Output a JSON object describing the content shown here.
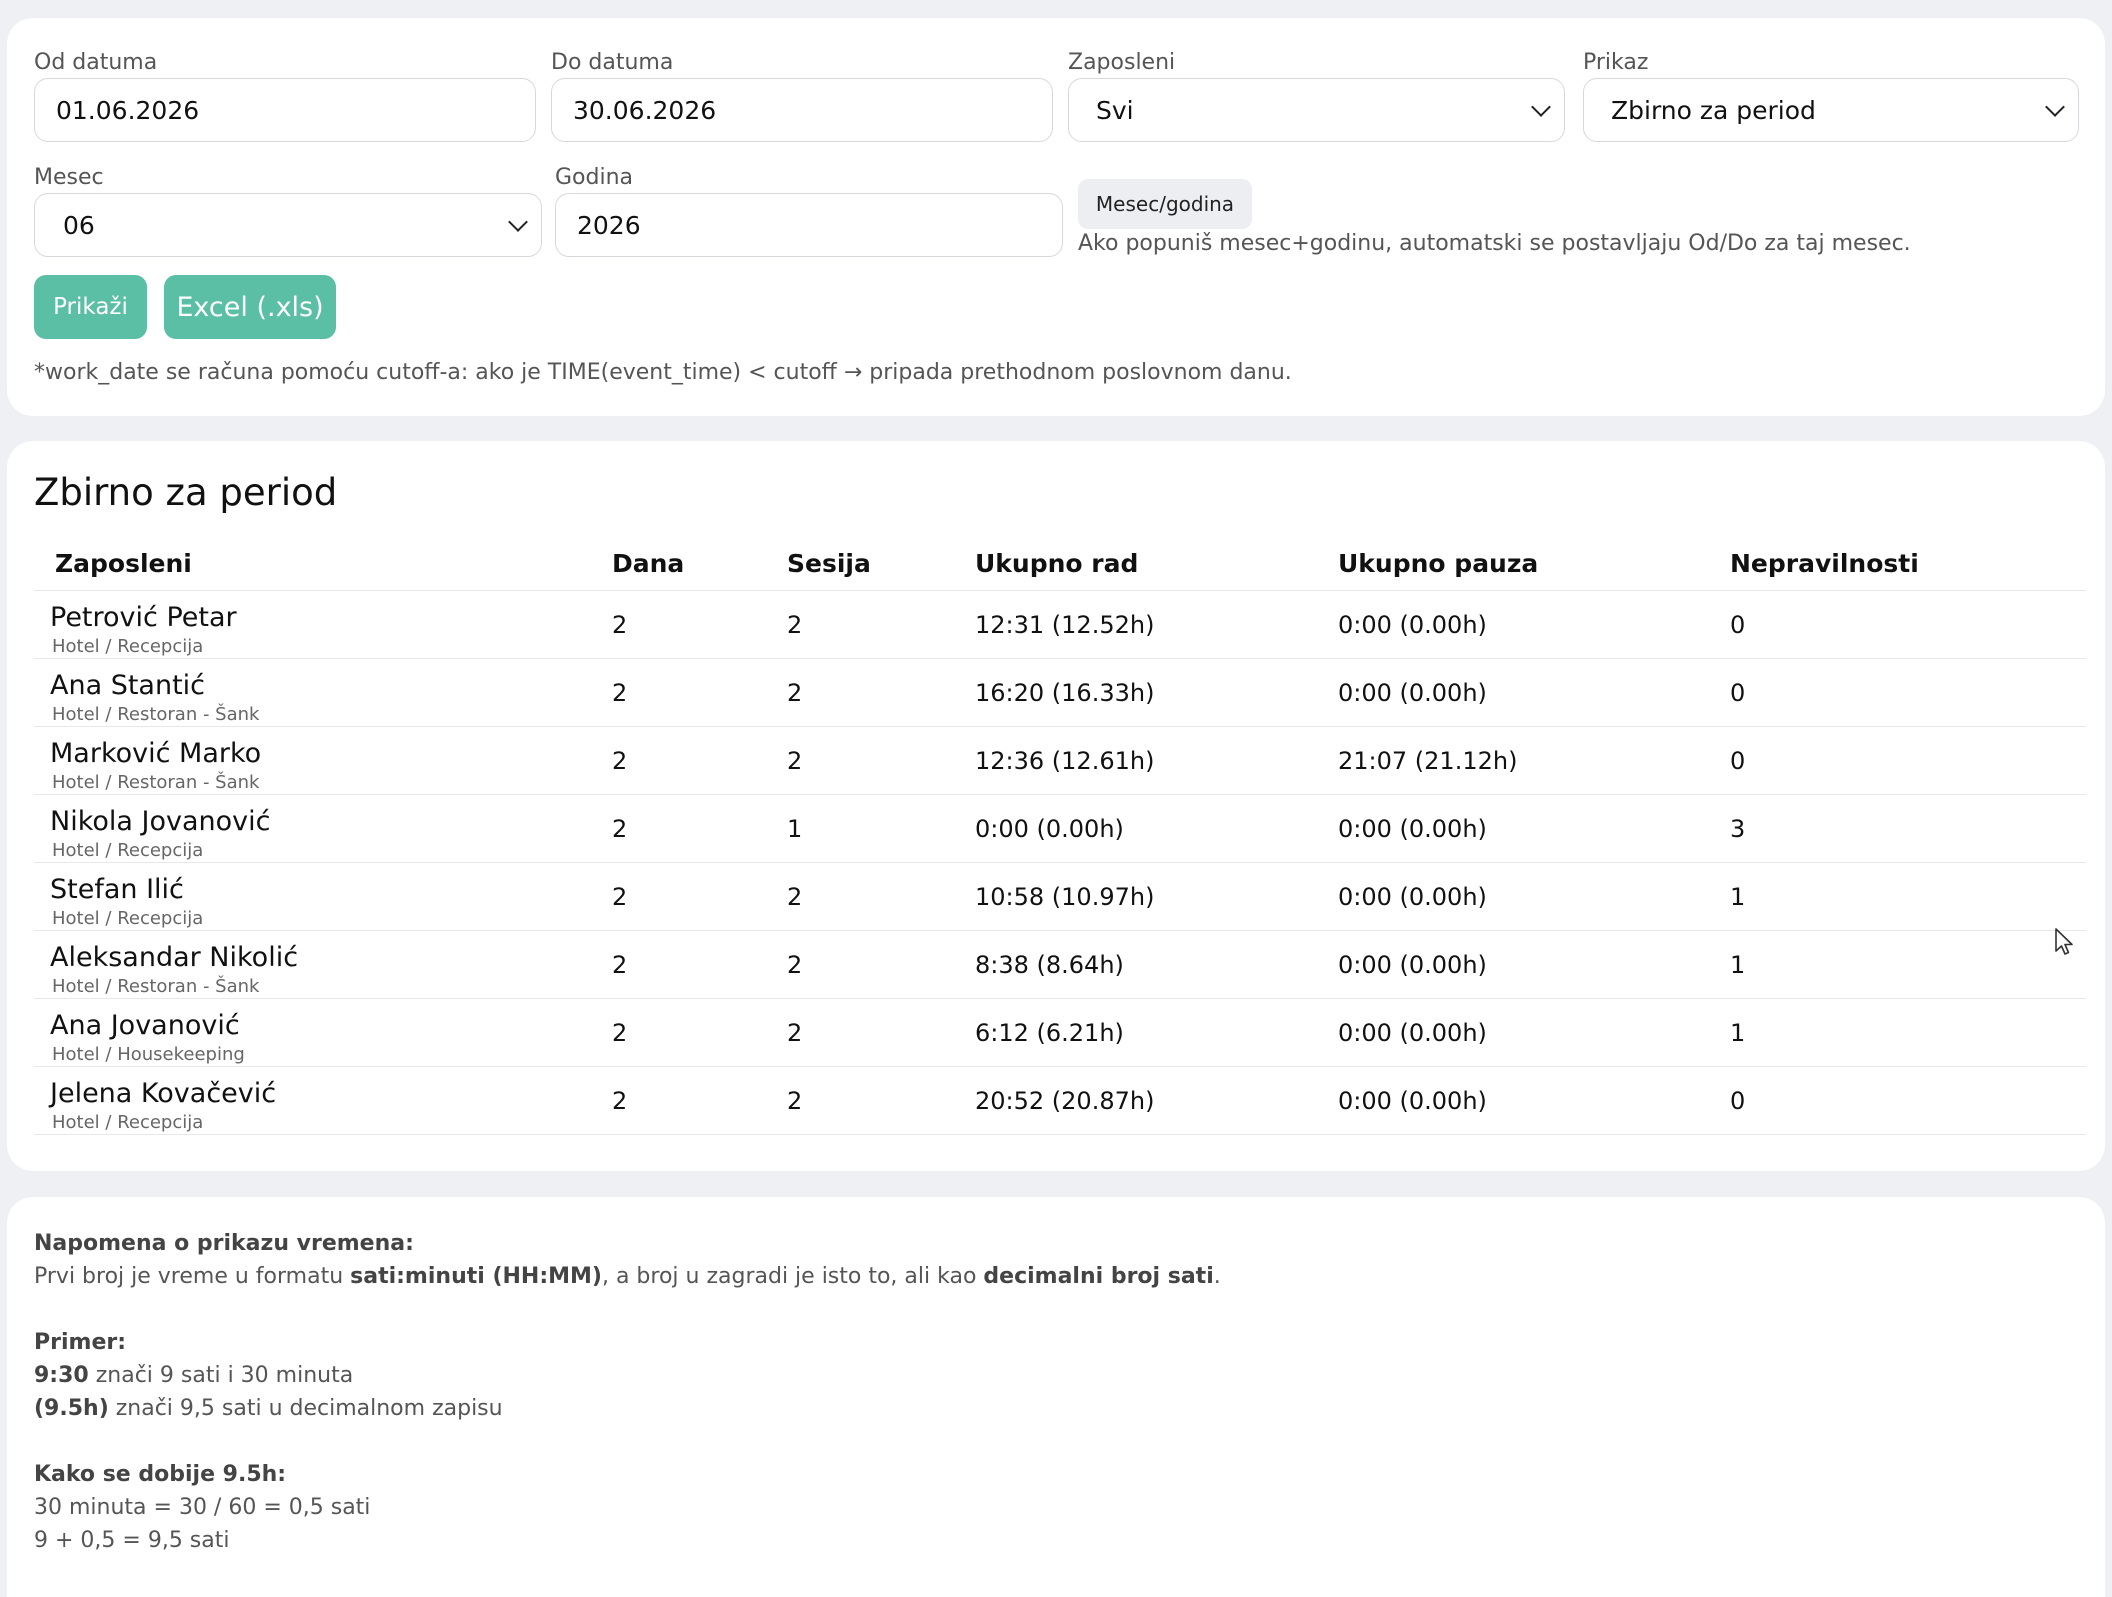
{
  "filters": {
    "from_label": "Od datuma",
    "from_value": "01.06.2026",
    "to_label": "Do datuma",
    "to_value": "30.06.2026",
    "employee_label": "Zaposleni",
    "employee_value": "Svi",
    "view_label": "Prikaz",
    "view_value": "Zbirno za period",
    "month_label": "Mesec",
    "month_value": "06",
    "year_label": "Godina",
    "year_value": "2026",
    "month_year_button": "Mesec/godina",
    "month_year_hint": "Ako popuniš mesec+godinu, automatski se postavljaju Od/Do za taj mesec.",
    "show_button": "Prikaži",
    "excel_button": "Excel (.xls)",
    "cutoff_note": "*work_date se računa pomoću cutoff-a: ako je TIME(event_time) < cutoff → pripada prethodnom poslovnom danu."
  },
  "results": {
    "title": "Zbirno za period",
    "columns": [
      "Zaposleni",
      "Dana",
      "Sesija",
      "Ukupno rad",
      "Ukupno pauza",
      "Nepravilnosti"
    ],
    "rows": [
      {
        "name": "Petrović Petar",
        "dept": "Hotel / Recepcija",
        "days": "2",
        "sessions": "2",
        "work": "12:31 (12.52h)",
        "pause": "0:00 (0.00h)",
        "irregular": "0"
      },
      {
        "name": "Ana Stantić",
        "dept": "Hotel / Restoran - Šank",
        "days": "2",
        "sessions": "2",
        "work": "16:20 (16.33h)",
        "pause": "0:00 (0.00h)",
        "irregular": "0"
      },
      {
        "name": "Marković Marko",
        "dept": "Hotel / Restoran - Šank",
        "days": "2",
        "sessions": "2",
        "work": "12:36 (12.61h)",
        "pause": "21:07 (21.12h)",
        "irregular": "0"
      },
      {
        "name": "Nikola Jovanović",
        "dept": "Hotel / Recepcija",
        "days": "2",
        "sessions": "1",
        "work": "0:00 (0.00h)",
        "pause": "0:00 (0.00h)",
        "irregular": "3"
      },
      {
        "name": "Stefan Ilić",
        "dept": "Hotel / Recepcija",
        "days": "2",
        "sessions": "2",
        "work": "10:58 (10.97h)",
        "pause": "0:00 (0.00h)",
        "irregular": "1"
      },
      {
        "name": "Aleksandar Nikolić",
        "dept": "Hotel / Restoran - Šank",
        "days": "2",
        "sessions": "2",
        "work": "8:38 (8.64h)",
        "pause": "0:00 (0.00h)",
        "irregular": "1"
      },
      {
        "name": "Ana Jovanović",
        "dept": "Hotel / Housekeeping",
        "days": "2",
        "sessions": "2",
        "work": "6:12 (6.21h)",
        "pause": "0:00 (0.00h)",
        "irregular": "1"
      },
      {
        "name": "Jelena Kovačević",
        "dept": "Hotel / Recepcija",
        "days": "2",
        "sessions": "2",
        "work": "20:52 (20.87h)",
        "pause": "0:00 (0.00h)",
        "irregular": "0"
      }
    ]
  },
  "note": {
    "heading": "Napomena o prikazu vremena:",
    "line1_a": "Prvi broj je vreme u formatu ",
    "line1_b": "sati:minuti (HH:MM)",
    "line1_c": ", a broj u zagradi je isto to, ali kao ",
    "line1_d": "decimalni broj sati",
    "line1_e": ".",
    "example_heading": "Primer:",
    "ex1_bold": "9:30",
    "ex1_text": " znači 9 sati i 30 minuta",
    "ex2_bold": "(9.5h)",
    "ex2_text": " znači 9,5 sati u decimalnom zapisu",
    "how_heading": "Kako se dobije 9.5h:",
    "calc1": "30 minuta = 30 / 60 = 0,5 sati",
    "calc2": "9 + 0,5 = 9,5 sati"
  },
  "colors": {
    "accent": "#5bbfa5",
    "background": "#eef0f4",
    "card": "#ffffff"
  }
}
